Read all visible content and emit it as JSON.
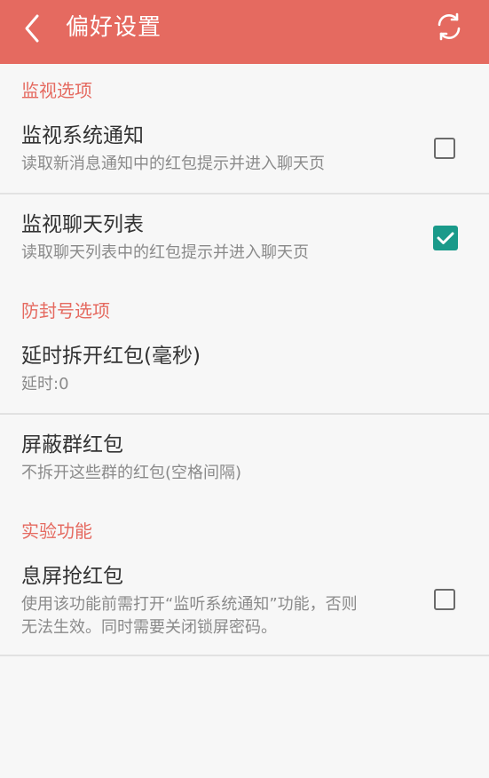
{
  "app_bar": {
    "title": "偏好设置",
    "back_icon": "chevron-left-icon",
    "refresh_icon": "refresh-icon",
    "color": "#e56a60"
  },
  "sections": {
    "monitor": {
      "header": "监视选项",
      "items": [
        {
          "title": "监视系统通知",
          "summary": "读取新消息通知中的红包提示并进入聊天页",
          "checked": false
        },
        {
          "title": "监视聊天列表",
          "summary": "读取聊天列表中的红包提示并进入聊天页",
          "checked": true
        }
      ]
    },
    "anti_ban": {
      "header": "防封号选项",
      "items": [
        {
          "title": "延时拆开红包(毫秒)",
          "summary": "延时:0"
        },
        {
          "title": "屏蔽群红包",
          "summary": "不拆开这些群的红包(空格间隔)"
        }
      ]
    },
    "experimental": {
      "header": "实验功能",
      "items": [
        {
          "title": "息屏抢红包",
          "summary_line1": "使用该功能前需打开“监听系统通知”功能，否则",
          "summary_line2": "无法生效。同时需要关闭锁屏密码。",
          "checked": false
        }
      ]
    }
  },
  "colors": {
    "accent": "#e56a60",
    "checkbox_checked": "#1a9a8a"
  }
}
